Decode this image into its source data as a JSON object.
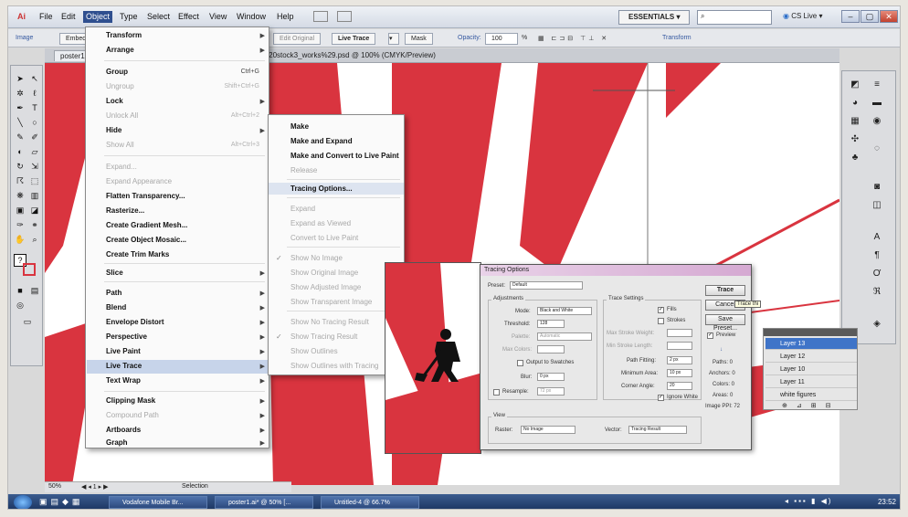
{
  "app": {
    "menus": [
      "File",
      "Edit",
      "Object",
      "Type",
      "Select",
      "Effect",
      "View",
      "Window",
      "Help"
    ],
    "workspace": "ESSENTIALS",
    "cs_live": "CS Live"
  },
  "control_bar": {
    "image_label": "Image",
    "embed_label": "Embed",
    "edit_original": "Edit Original",
    "live_trace": "Live Trace",
    "mask": "Mask",
    "opacity_label": "Opacity:",
    "opacity_value": "100",
    "transform": "Transform"
  },
  "document": {
    "tab1": "poster1",
    "tab2": "%20stock3_works%29.psd @ 100% (CMYK/Preview)",
    "zoom": "50%",
    "selection_label": "Selection"
  },
  "object_menu": [
    {
      "label": "Transform",
      "shortcut": "",
      "arrow": true,
      "disabled": false
    },
    {
      "label": "Arrange",
      "shortcut": "",
      "arrow": true,
      "disabled": false
    },
    {
      "label": "Group",
      "shortcut": "Ctrl+G",
      "arrow": false,
      "disabled": false
    },
    {
      "label": "Ungroup",
      "shortcut": "Shift+Ctrl+G",
      "arrow": false,
      "disabled": true
    },
    {
      "label": "Lock",
      "shortcut": "",
      "arrow": true,
      "disabled": false
    },
    {
      "label": "Unlock All",
      "shortcut": "Alt+Ctrl+2",
      "arrow": false,
      "disabled": true
    },
    {
      "label": "Hide",
      "shortcut": "",
      "arrow": true,
      "disabled": false
    },
    {
      "label": "Show All",
      "shortcut": "Alt+Ctrl+3",
      "arrow": false,
      "disabled": true
    },
    {
      "label": "Expand...",
      "shortcut": "",
      "arrow": false,
      "disabled": true
    },
    {
      "label": "Expand Appearance",
      "shortcut": "",
      "arrow": false,
      "disabled": true
    },
    {
      "label": "Flatten Transparency...",
      "shortcut": "",
      "arrow": false,
      "disabled": false
    },
    {
      "label": "Rasterize...",
      "shortcut": "",
      "arrow": false,
      "disabled": false
    },
    {
      "label": "Create Gradient Mesh...",
      "shortcut": "",
      "arrow": false,
      "disabled": false
    },
    {
      "label": "Create Object Mosaic...",
      "shortcut": "",
      "arrow": false,
      "disabled": false
    },
    {
      "label": "Create Trim Marks",
      "shortcut": "",
      "arrow": false,
      "disabled": false
    },
    {
      "label": "Slice",
      "shortcut": "",
      "arrow": true,
      "disabled": false
    },
    {
      "label": "Path",
      "shortcut": "",
      "arrow": true,
      "disabled": false
    },
    {
      "label": "Blend",
      "shortcut": "",
      "arrow": true,
      "disabled": false
    },
    {
      "label": "Envelope Distort",
      "shortcut": "",
      "arrow": true,
      "disabled": false
    },
    {
      "label": "Perspective",
      "shortcut": "",
      "arrow": true,
      "disabled": false
    },
    {
      "label": "Live Paint",
      "shortcut": "",
      "arrow": true,
      "disabled": false
    },
    {
      "label": "Live Trace",
      "shortcut": "",
      "arrow": true,
      "disabled": false
    },
    {
      "label": "Text Wrap",
      "shortcut": "",
      "arrow": true,
      "disabled": false
    },
    {
      "label": "Clipping Mask",
      "shortcut": "",
      "arrow": true,
      "disabled": false
    },
    {
      "label": "Compound Path",
      "shortcut": "",
      "arrow": true,
      "disabled": true
    },
    {
      "label": "Artboards",
      "shortcut": "",
      "arrow": true,
      "disabled": false
    },
    {
      "label": "Graph",
      "shortcut": "",
      "arrow": true,
      "disabled": false
    }
  ],
  "live_trace_submenu": [
    {
      "label": "Make",
      "disabled": false,
      "checked": false
    },
    {
      "label": "Make and Expand",
      "disabled": false,
      "checked": false
    },
    {
      "label": "Make and Convert to Live Paint",
      "disabled": false,
      "checked": false
    },
    {
      "label": "Release",
      "disabled": true,
      "checked": false
    },
    {
      "label": "Tracing Options...",
      "disabled": false,
      "checked": false
    },
    {
      "label": "Expand",
      "disabled": true,
      "checked": false
    },
    {
      "label": "Expand as Viewed",
      "disabled": true,
      "checked": false
    },
    {
      "label": "Convert to Live Paint",
      "disabled": true,
      "checked": false
    },
    {
      "label": "Show No Image",
      "disabled": true,
      "checked": true
    },
    {
      "label": "Show Original Image",
      "disabled": true,
      "checked": false
    },
    {
      "label": "Show Adjusted Image",
      "disabled": true,
      "checked": false
    },
    {
      "label": "Show Transparent Image",
      "disabled": true,
      "checked": false
    },
    {
      "label": "Show No Tracing Result",
      "disabled": true,
      "checked": false
    },
    {
      "label": "Show Tracing Result",
      "disabled": true,
      "checked": true
    },
    {
      "label": "Show Outlines",
      "disabled": true,
      "checked": false
    },
    {
      "label": "Show Outlines with Tracing",
      "disabled": true,
      "checked": false
    }
  ],
  "tracing_dialog": {
    "title": "Tracing Options",
    "preset_label": "Preset:",
    "preset_value": "Default",
    "adjustments_label": "Adjustments",
    "mode_label": "Mode:",
    "mode_value": "Black and White",
    "threshold_label": "Threshold:",
    "threshold_value": "128",
    "palette_label": "Palette:",
    "palette_value": "Automatic",
    "max_colors_label": "Max Colors:",
    "output_swatches": "Output to Swatches",
    "blur_label": "Blur:",
    "blur_value": "0 px",
    "resample_label": "Resample:",
    "resample_value": "72 px",
    "trace_settings_label": "Trace Settings",
    "fills": "Fills",
    "strokes": "Strokes",
    "max_stroke_weight": "Max Stroke Weight:",
    "min_stroke_length": "Min Stroke Length:",
    "path_fitting_label": "Path Fitting:",
    "path_fitting_value": "2 px",
    "min_area_label": "Minimum Area:",
    "min_area_value": "10 px",
    "corner_angle_label": "Corner Angle:",
    "corner_angle_value": "20",
    "ignore_white": "Ignore White",
    "view_label": "View",
    "raster_label": "Raster:",
    "raster_value": "No Image",
    "vector_label": "Vector:",
    "vector_value": "Tracing Result",
    "btn_trace": "Trace",
    "btn_cancel": "Cancel",
    "btn_save": "Save Preset...",
    "preview": "Preview",
    "stats": [
      "Paths: 0",
      "Anchors: 0",
      "Colors: 0",
      "Areas: 0",
      "Image PPI: 72"
    ],
    "tooltip": "Trace thi"
  },
  "layers": [
    "Layer 13",
    "Layer 12",
    "Layer 10",
    "Layer 11",
    "white figures"
  ],
  "taskbar": {
    "items": [
      "Vodafone Mobile Br...",
      "poster1.ai* @ 50% [...",
      "Untitled-4 @ 66.7%"
    ],
    "clock": "23:52"
  },
  "colors": {
    "red": "#d9343f",
    "menu_bg": "#fafafa"
  }
}
